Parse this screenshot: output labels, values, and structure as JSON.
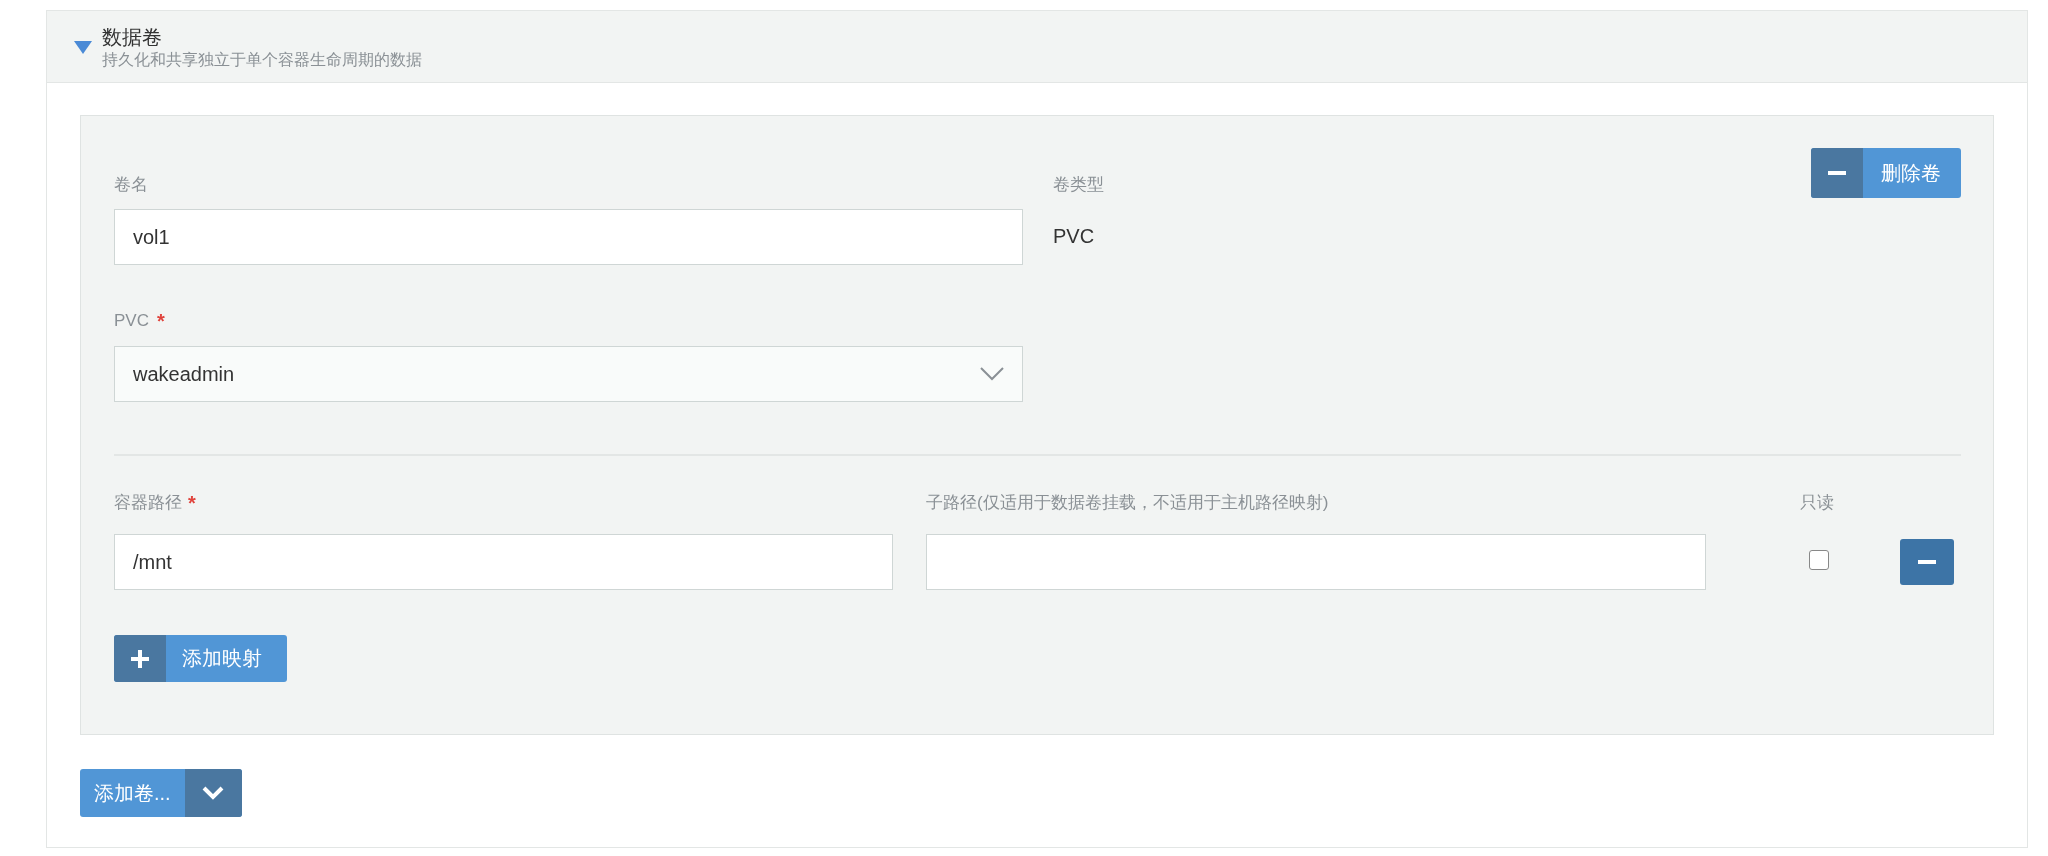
{
  "section": {
    "title": "数据卷",
    "subtitle": "持久化和共享独立于单个容器生命周期的数据",
    "expanded": true
  },
  "volume": {
    "name_label": "卷名",
    "name_value": "vol1",
    "type_label": "卷类型",
    "type_value": "PVC",
    "remove_button": "删除卷",
    "pvc_label": "PVC",
    "pvc_required_mark": "*",
    "pvc_value": "wakeadmin",
    "mapping_columns": [
      {
        "label": "容器路径",
        "required_mark": "*"
      },
      {
        "label": "子路径(仅适用于数据卷挂载，不适用于主机路径映射)"
      },
      {
        "label": "只读"
      }
    ],
    "mappings": [
      {
        "container_path": "/mnt",
        "read_only": false
      }
    ],
    "add_mapping_button": "添加映射"
  },
  "add_volume_button": "添加卷..."
}
